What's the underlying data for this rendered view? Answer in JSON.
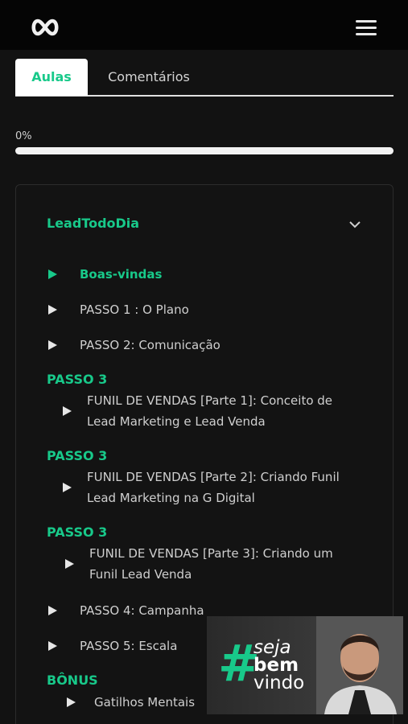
{
  "header": {
    "logo_icon": "infinity-icon",
    "menu_icon": "hamburger-menu-icon"
  },
  "tabs": [
    {
      "label": "Aulas",
      "active": true
    },
    {
      "label": "Comentários",
      "active": false
    }
  ],
  "progress": {
    "label": "0%",
    "value": 0
  },
  "module": {
    "title": "LeadTodoDia",
    "lessons_top": [
      {
        "label": "Boas-vindas",
        "active": true
      },
      {
        "label": "PASSO 1 : O Plano"
      },
      {
        "label": "PASSO 2: Comunicação"
      }
    ],
    "sections": [
      {
        "title": "PASSO 3",
        "lesson": "FUNIL DE VENDAS [Parte 1]: Conceito de Lead Marketing e Lead Venda"
      },
      {
        "title": "PASSO 3",
        "lesson": "FUNIL DE VENDAS [Parte 2]: Criando Funil Lead Marketing na G Digital"
      },
      {
        "title": "PASSO 3",
        "lesson": "FUNIL DE VENDAS [Parte 3]: Criando um Funil Lead Venda"
      }
    ],
    "lessons_bottom": [
      {
        "label": "PASSO 4: Campanha"
      },
      {
        "label": "PASSO 5: Escala"
      }
    ],
    "bonus": {
      "title": "BÔNUS",
      "lesson": "Gatilhos Mentais"
    }
  },
  "video_overlay": {
    "hash": "#",
    "line1": "seja",
    "line2": "bem",
    "line3": "vindo"
  },
  "colors": {
    "accent": "#18c98a",
    "background": "#121212",
    "topbar": "#050505"
  }
}
